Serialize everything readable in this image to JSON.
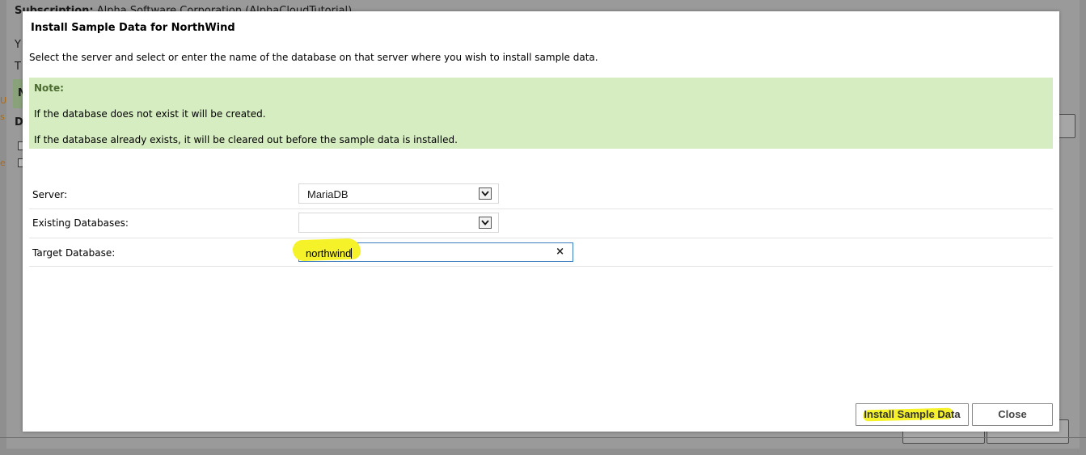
{
  "background": {
    "title_bold": "Subscription:",
    "title_rest": "Alpha Software Corporation (AlphaCloudTutorial)",
    "letters": [
      "Y",
      "T",
      "N",
      "D"
    ],
    "orange_letters": [
      "U",
      "s",
      "e"
    ]
  },
  "dialog": {
    "title": "Install Sample Data for NorthWind",
    "description": "Select the server and select or enter the name of the database on that server where you wish to install sample data.",
    "note": {
      "heading": "Note:",
      "line1": "If the database does not exist it will be created.",
      "line2": "If the database already exists, it will be cleared out before the sample data is installed."
    },
    "form": {
      "server_label": "Server:",
      "server_value": "MariaDB",
      "existing_label": "Existing Databases:",
      "existing_value": "",
      "target_label": "Target Database:",
      "target_value": "northwind",
      "clear_icon": "×"
    },
    "buttons": {
      "install_label": "Install Sample Data",
      "close_label": "Close"
    }
  },
  "colors": {
    "note_background": "#d5edc0",
    "note_heading": "#4c6b30",
    "input_focus_border": "#3d7bbf",
    "highlight": "#f5f22a"
  }
}
